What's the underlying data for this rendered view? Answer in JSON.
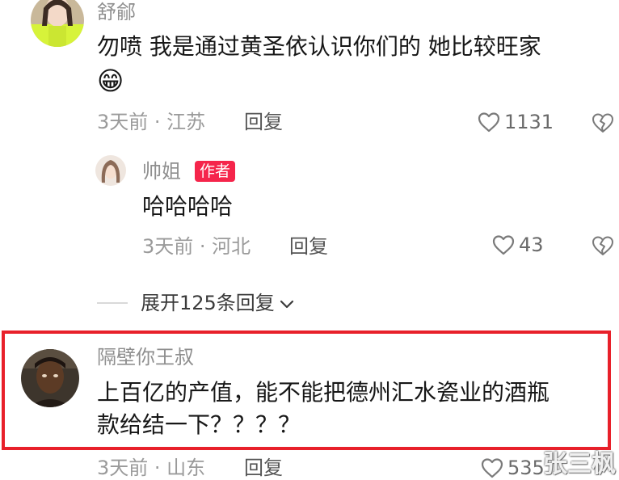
{
  "comments": [
    {
      "username": "舒鄃",
      "text_line1": "勿喷 我是通过黄圣依认识你们的 她比较旺家",
      "emoji": "😁",
      "time_location": "3天前 · 江苏",
      "reply_label": "回复",
      "likes": "1131"
    },
    {
      "username": "帅姐",
      "badge": "作者",
      "text_line1": "哈哈哈哈",
      "time_location": "3天前 · 河北",
      "reply_label": "回复",
      "likes": "43"
    },
    {
      "username": "隔壁你王叔",
      "text_line1": "上百亿的产值，能不能把德州汇水瓷业的酒瓶",
      "text_line2": "款给结一下？？？？",
      "time_location": "3天前 · 山东",
      "reply_label": "回复",
      "likes": "535"
    }
  ],
  "expand_replies_label": "展开125条回复",
  "watermark": "张三枫",
  "icons": {
    "like": "heart-outline-icon",
    "dislike": "broken-heart-icon",
    "expand": "chevron-down-icon"
  },
  "colors": {
    "author_badge": "#f5254b",
    "highlight_border": "#e8202a",
    "muted_text": "#9a9a9a"
  }
}
